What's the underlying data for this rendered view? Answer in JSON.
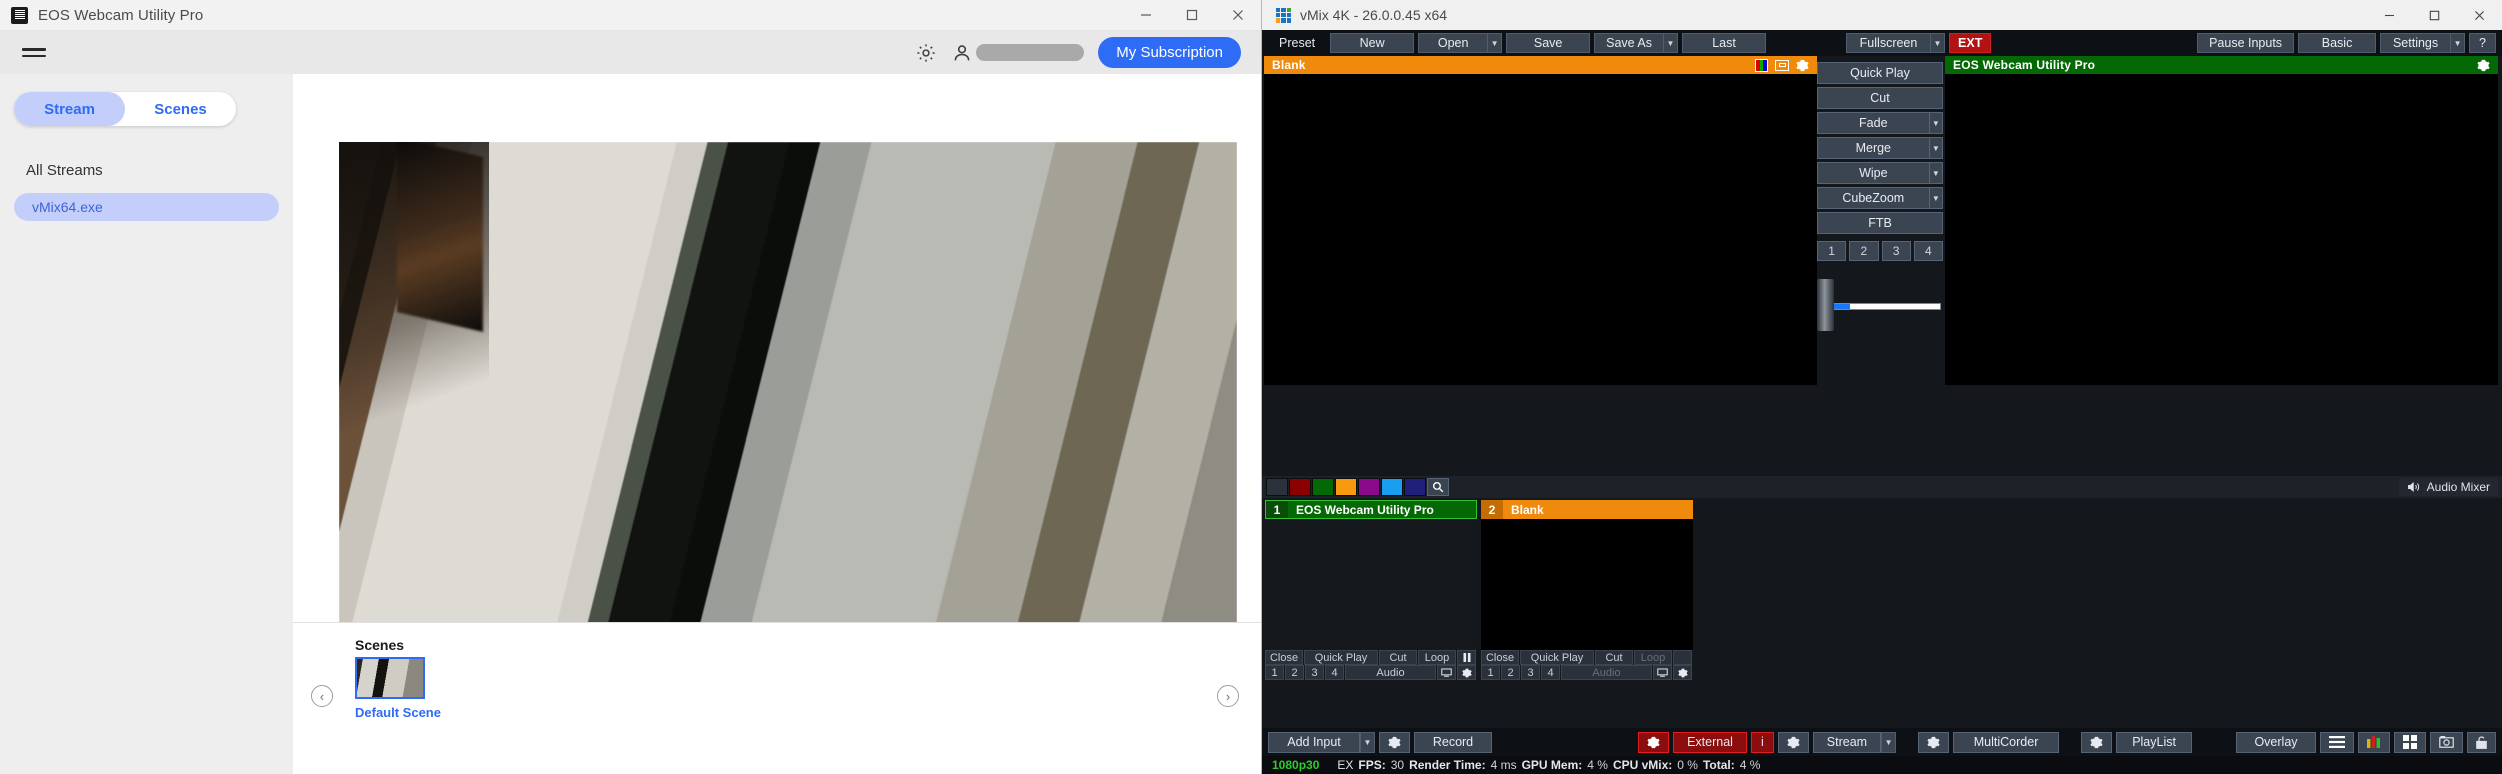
{
  "eos": {
    "window_title": "EOS Webcam Utility Pro",
    "window_controls": {
      "minimize": "minimize-icon",
      "maximize": "maximize-icon",
      "close": "close-icon"
    },
    "menu_icon": "hamburger-icon",
    "settings_icon": "gear-icon",
    "account_icon": "user-icon",
    "subscription_button": "My Subscription",
    "tabs": [
      {
        "label": "Stream",
        "active": true
      },
      {
        "label": "Scenes",
        "active": false
      }
    ],
    "sidebar": {
      "section_label": "All Streams",
      "items": [
        {
          "label": "vMix64.exe",
          "selected": true
        }
      ]
    },
    "scenes": {
      "heading": "Scenes",
      "prev_arrow": "‹",
      "next_arrow": "›",
      "items": [
        {
          "label": "Default Scene",
          "selected": true
        }
      ]
    }
  },
  "vmix": {
    "window_title": "vMix 4K - 26.0.0.45 x64",
    "window_controls": {
      "minimize": "minimize-icon",
      "maximize": "maximize-icon",
      "close": "close-icon"
    },
    "toolbar": {
      "preset_label": "Preset",
      "buttons": [
        {
          "label": "New",
          "caret": false
        },
        {
          "label": "Open",
          "caret": true
        },
        {
          "label": "Save",
          "caret": false
        },
        {
          "label": "Save As",
          "caret": true
        },
        {
          "label": "Last",
          "caret": false
        }
      ],
      "fullscreen": {
        "label": "Fullscreen",
        "caret": true
      },
      "ext": "EXT",
      "right_buttons": [
        {
          "label": "Pause Inputs",
          "caret": false
        },
        {
          "label": "Basic",
          "caret": false
        },
        {
          "label": "Settings",
          "caret": true
        }
      ],
      "help": "?"
    },
    "preview_panel": {
      "title": "Blank",
      "icons": [
        "color-bars-icon",
        "monitor-icon",
        "gear-icon"
      ],
      "accent": "#f08a0c"
    },
    "program_panel": {
      "title": "EOS Webcam Utility Pro",
      "icons": [
        "gear-icon"
      ],
      "accent": "#046804"
    },
    "transitions": {
      "quick_play": "Quick Play",
      "cut": "Cut",
      "items": [
        {
          "label": "Fade",
          "caret": true
        },
        {
          "label": "Merge",
          "caret": true
        },
        {
          "label": "Wipe",
          "caret": true
        },
        {
          "label": "CubeZoom",
          "caret": true
        }
      ],
      "ftb": "FTB",
      "numbers": [
        "1",
        "2",
        "3",
        "4"
      ],
      "tbar_position_percent": 22
    },
    "input_bar": {
      "swatches": [
        "#2c323b",
        "#8b0000",
        "#046804",
        "#f79a10",
        "#8b0a8b",
        "#1a9ff0",
        "#20207a"
      ],
      "search_icon": "search-icon",
      "audio_mixer": {
        "label": "Audio Mixer",
        "icon": "speaker-icon"
      }
    },
    "inputs": [
      {
        "number": "1",
        "name": "EOS Webcam Utility Pro",
        "state": "program",
        "row1": [
          "Close",
          "Quick Play",
          "Cut",
          "Loop"
        ],
        "row1_extra": "pause-icon",
        "row2_numbers": [
          "1",
          "2",
          "3",
          "4"
        ],
        "row2_audio": "Audio",
        "row2_icons": [
          "monitor-icon",
          "gear-icon"
        ],
        "disabled": []
      },
      {
        "number": "2",
        "name": "Blank",
        "state": "preview",
        "row1": [
          "Close",
          "Quick Play",
          "Cut",
          "Loop"
        ],
        "row1_extra": "",
        "row2_numbers": [
          "1",
          "2",
          "3",
          "4"
        ],
        "row2_audio": "Audio",
        "row2_icons": [
          "monitor-icon",
          "gear-icon"
        ],
        "disabled": [
          "Loop",
          "Audio"
        ]
      }
    ],
    "bottom_bar": {
      "add_input": "Add Input",
      "add_input_settings_icon": "gear-icon",
      "record": "Record",
      "external_settings_icon": "gear-icon",
      "external": "External",
      "external_info": "i",
      "stream_settings_icon": "gear-icon",
      "stream": "Stream",
      "multicorder_settings_icon": "gear-icon",
      "multicorder": "MultiCorder",
      "playlist_settings_icon": "gear-icon",
      "playlist": "PlayList",
      "overlay": "Overlay",
      "icon_buttons": [
        "list-icon",
        "audio-levels-icon",
        "multiview-icon",
        "snapshot-icon",
        "lock-icon"
      ]
    },
    "status_bar": {
      "resolution": "1080p30",
      "ex": "EX",
      "fps_label": "FPS:",
      "fps_value": "30",
      "render_label": "Render Time:",
      "render_value": "4 ms",
      "gpu_label": "GPU Mem:",
      "gpu_value": "4 %",
      "cpu_label": "CPU vMix:",
      "cpu_value": "0 %",
      "total_label": "Total:",
      "total_value": "4 %"
    }
  }
}
